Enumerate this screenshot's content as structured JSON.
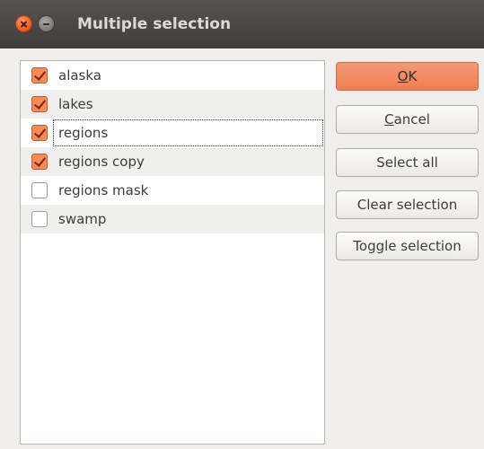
{
  "window": {
    "title": "Multiple selection",
    "accent": "#e95420"
  },
  "list": {
    "items": [
      {
        "label": "alaska",
        "checked": true
      },
      {
        "label": "lakes",
        "checked": true
      },
      {
        "label": "regions",
        "checked": true
      },
      {
        "label": "regions copy",
        "checked": true
      },
      {
        "label": "regions mask",
        "checked": false
      },
      {
        "label": "swamp",
        "checked": false
      }
    ]
  },
  "buttons": {
    "ok": {
      "mnemonic": "O",
      "rest": "K"
    },
    "cancel": {
      "mnemonic": "C",
      "rest": "ancel"
    },
    "select_all": "Select all",
    "clear_selection": "Clear selection",
    "toggle_selection": "Toggle selection"
  }
}
